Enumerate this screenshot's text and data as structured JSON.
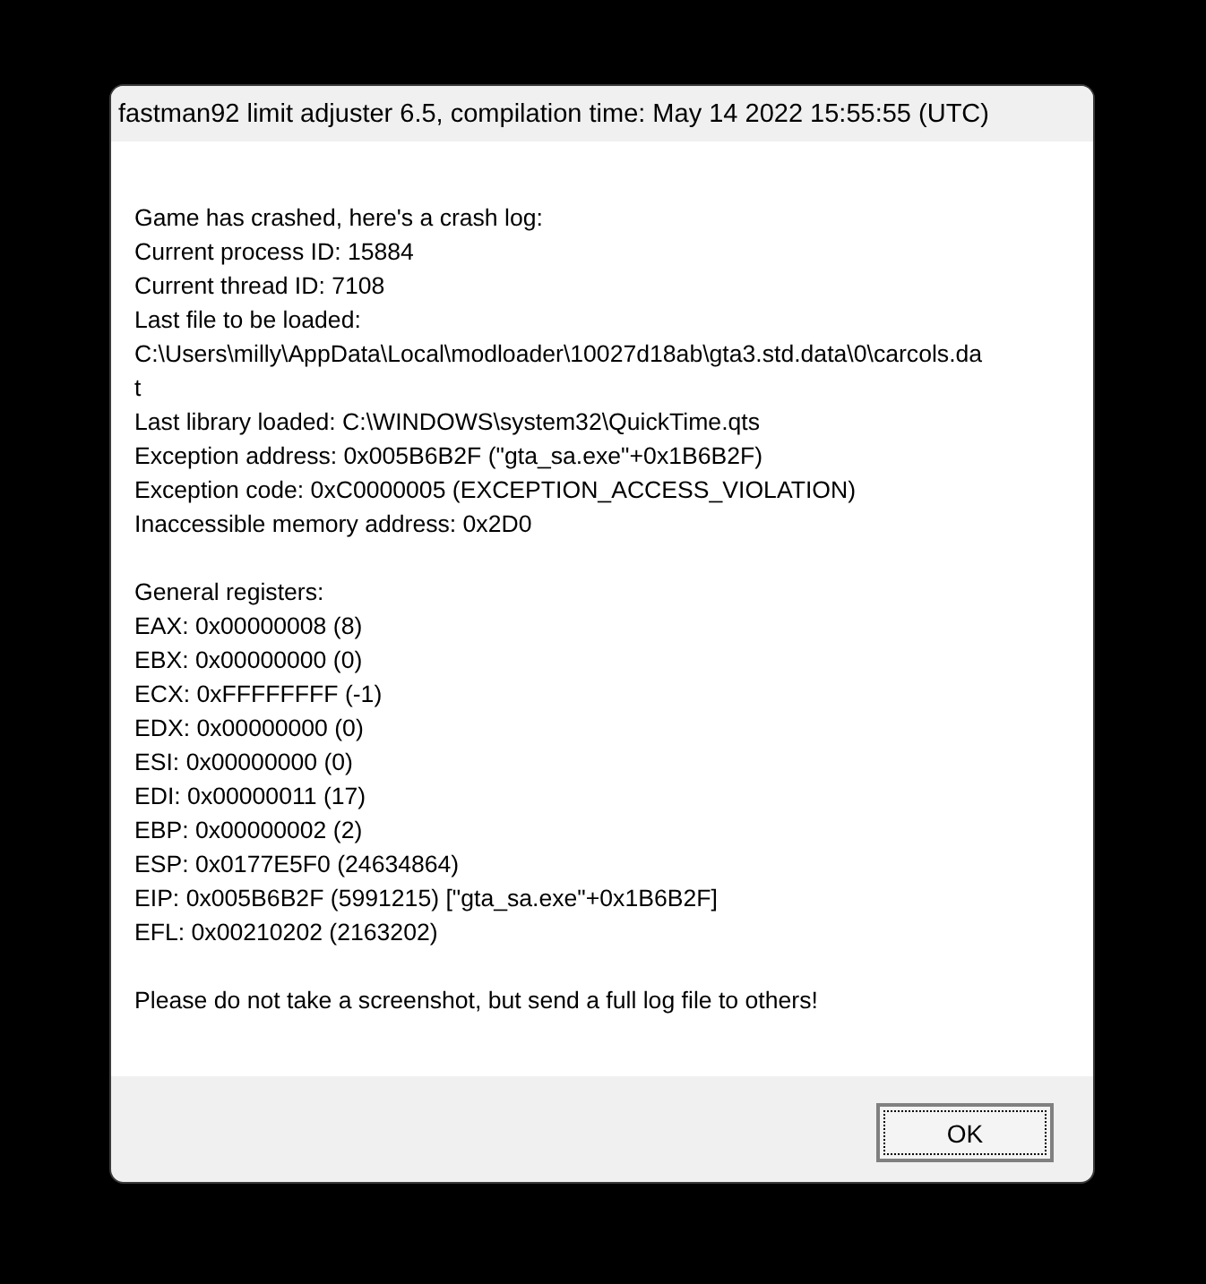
{
  "window": {
    "title": "fastman92 limit adjuster 6.5, compilation time: May 14 2022 15:55:55 (UTC)"
  },
  "message": {
    "paragraphs": [
      [
        "Game has crashed, here's a crash log:",
        "Current process ID: 15884",
        "Current thread ID: 7108",
        "Last file to be loaded:",
        "C:\\Users\\milly\\AppData\\Local\\modloader\\10027d18ab\\gta3.std.data\\0\\carcols.da",
        "t",
        "Last library loaded: C:\\WINDOWS\\system32\\QuickTime.qts",
        "Exception address: 0x005B6B2F (\"gta_sa.exe\"+0x1B6B2F)",
        "Exception code: 0xC0000005 (EXCEPTION_ACCESS_VIOLATION)",
        "Inaccessible memory address: 0x2D0"
      ],
      [
        "General registers:",
        "EAX: 0x00000008 (8)",
        "EBX: 0x00000000 (0)",
        "ECX: 0xFFFFFFFF (-1)",
        "EDX: 0x00000000 (0)",
        "ESI: 0x00000000 (0)",
        "EDI: 0x00000011 (17)",
        "EBP: 0x00000002 (2)",
        "ESP: 0x0177E5F0 (24634864)",
        "EIP: 0x005B6B2F (5991215) [\"gta_sa.exe\"+0x1B6B2F]",
        "EFL: 0x00210202 (2163202)"
      ],
      [
        "Please do not take a screenshot, but send a full log file to others!"
      ]
    ]
  },
  "buttons": [
    {
      "label": "OK",
      "focused": true
    }
  ]
}
